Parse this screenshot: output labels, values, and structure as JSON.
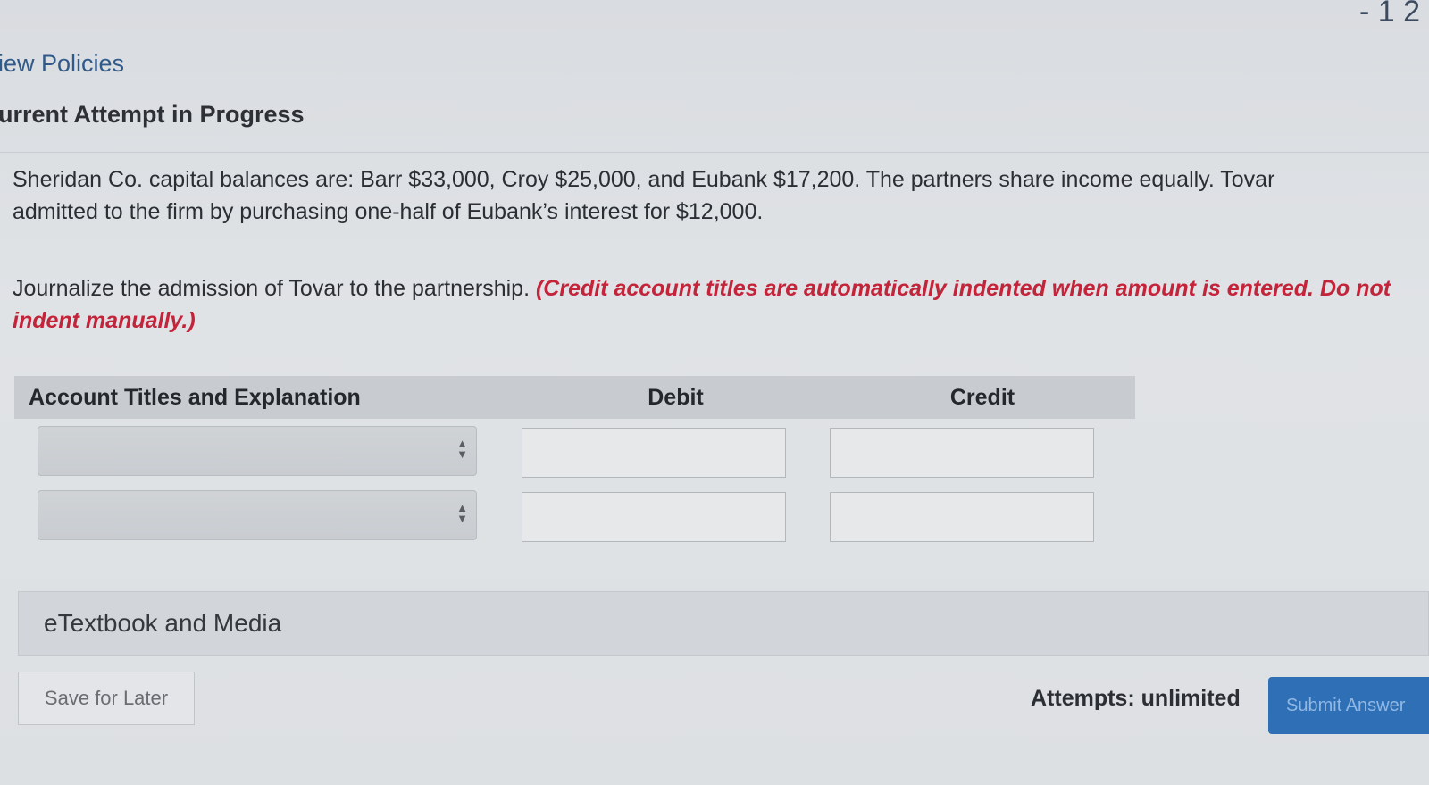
{
  "corner_text": "- 1 2",
  "view_policies_label": "iew Policies",
  "attempt_title": "urrent Attempt in Progress",
  "question": {
    "line1": "Sheridan Co. capital balances are: Barr $33,000, Croy $25,000, and Eubank $17,200. The partners share income equally. Tovar",
    "line2": "admitted to the firm by purchasing one-half of Eubank’s interest for $12,000."
  },
  "instruction": {
    "text": "Journalize the admission of Tovar to the partnership. ",
    "note": "(Credit account titles are automatically indented when amount is entered. Do not indent manually.)"
  },
  "journal_table": {
    "headers": [
      "Account Titles and Explanation",
      "Debit",
      "Credit"
    ],
    "rows": [
      {
        "account": "",
        "debit": "",
        "credit": ""
      },
      {
        "account": "",
        "debit": "",
        "credit": ""
      }
    ]
  },
  "etextbook_label": "eTextbook and Media",
  "save_button_label": "Save for Later",
  "attempts_text": "Attempts: unlimited",
  "submit_button_label": "Submit Answer",
  "colors": {
    "link": "#305a8a",
    "note_red": "#c3243a",
    "submit_blue": "#2e6fb5"
  }
}
